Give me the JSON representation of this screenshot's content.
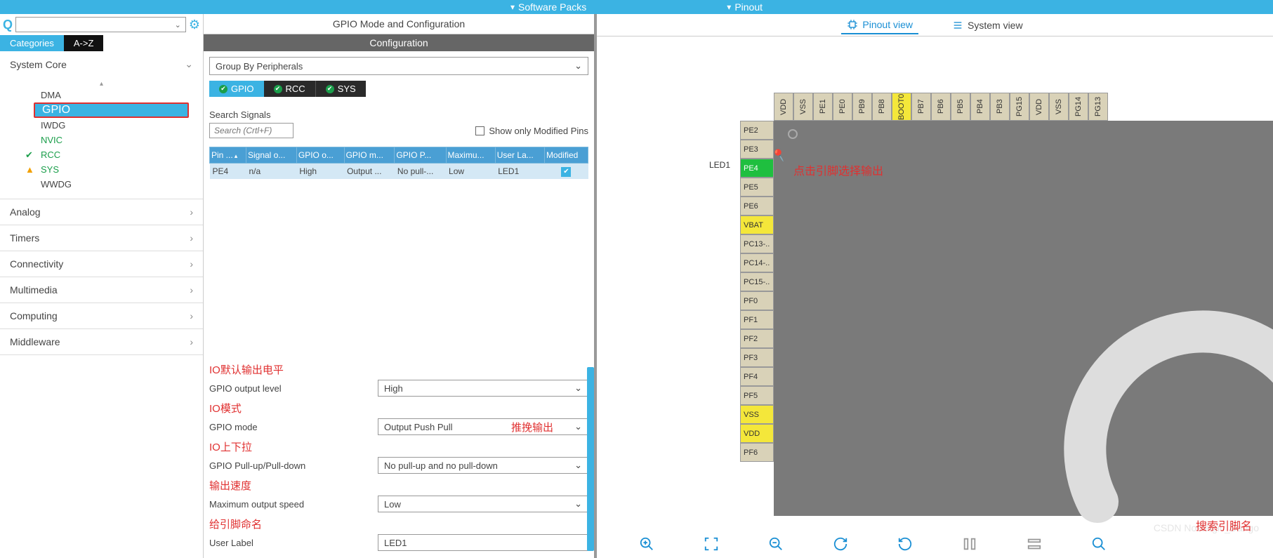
{
  "topBar": {
    "item1": "Software Packs",
    "item2": "Pinout"
  },
  "viewTabs": {
    "pinout": "Pinout view",
    "system": "System view"
  },
  "sidebar": {
    "tabs": {
      "categories": "Categories",
      "az": "A->Z"
    },
    "sections": {
      "systemCore": "System Core",
      "analog": "Analog",
      "timers": "Timers",
      "connectivity": "Connectivity",
      "multimedia": "Multimedia",
      "computing": "Computing",
      "middleware": "Middleware"
    },
    "items": {
      "dma": "DMA",
      "gpio": "GPIO",
      "iwdg": "IWDG",
      "nvic": "NVIC",
      "rcc": "RCC",
      "sys": "SYS",
      "wwdg": "WWDG"
    }
  },
  "mid": {
    "title": "GPIO Mode and Configuration",
    "subtitle": "Configuration",
    "groupBy": "Group By Peripherals",
    "ptabs": {
      "gpio": "GPIO",
      "rcc": "RCC",
      "sys": "SYS"
    },
    "searchLabel": "Search Signals",
    "searchPlaceholder": "Search (Crtl+F)",
    "showModified": "Show only Modified Pins",
    "tableHeaders": {
      "pin": "Pin ...",
      "signal": "Signal o...",
      "gpioO": "GPIO o...",
      "gpioM": "GPIO m...",
      "gpioP": "GPIO P...",
      "maxO": "Maximu...",
      "userL": "User La...",
      "mod": "Modified"
    },
    "row": {
      "pin": "PE4",
      "signal": "n/a",
      "gpioO": "High",
      "gpioM": "Output ...",
      "gpioP": "No pull-...",
      "maxO": "Low",
      "userL": "LED1"
    },
    "annos": {
      "a1": "IO默认输出电平",
      "a2": "IO模式",
      "a3": "IO上下拉",
      "a4": "输出速度",
      "a5": "给引脚命名",
      "push": "推挽输出"
    },
    "props": {
      "outputLevel": {
        "label": "GPIO output level",
        "value": "High"
      },
      "mode": {
        "label": "GPIO mode",
        "value": "Output Push Pull"
      },
      "pull": {
        "label": "GPIO Pull-up/Pull-down",
        "value": "No pull-up and no pull-down"
      },
      "speed": {
        "label": "Maximum output speed",
        "value": "Low"
      },
      "userLabel": {
        "label": "User Label",
        "value": "LED1"
      }
    }
  },
  "right": {
    "pinAnno": "点击引脚选择输出",
    "searchAnno": "搜索引脚名",
    "pinLabel": "LED1",
    "topPins": [
      "VDD",
      "VSS",
      "PE1",
      "PE0",
      "PB9",
      "PB8",
      "BOOT0",
      "PB7",
      "PB6",
      "PB5",
      "PB4",
      "PB3",
      "PG15",
      "VDD",
      "VSS",
      "PG14",
      "PG13"
    ],
    "topYellowIdx": 6,
    "leftPins": [
      "PE2",
      "PE3",
      "PE4",
      "PE5",
      "PE6",
      "VBAT",
      "PC13-..",
      "PC14-..",
      "PC15-..",
      "PF0",
      "PF1",
      "PF2",
      "PF3",
      "PF4",
      "PF5",
      "VSS",
      "VDD",
      "PF6"
    ]
  },
  "watermark": "CSDN Nostalgic_Dango"
}
